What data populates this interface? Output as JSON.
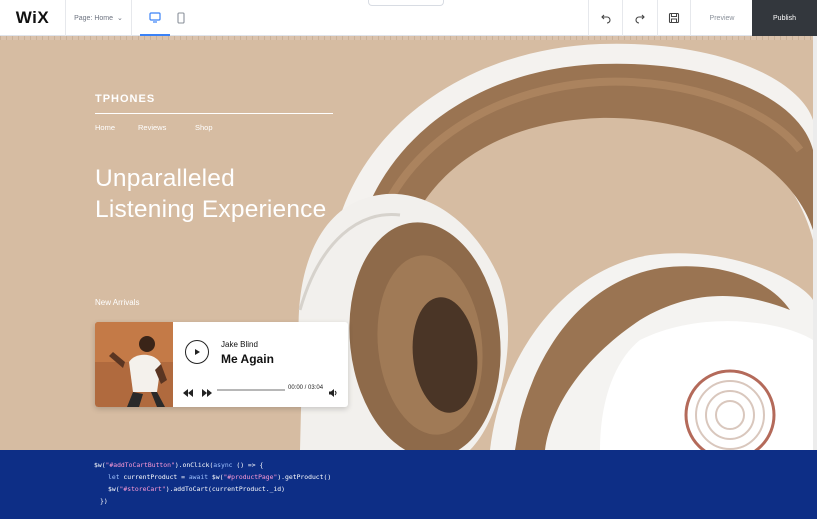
{
  "editor": {
    "logo": "WiX",
    "page_select_label": "Page: Home",
    "preview_label": "Preview",
    "publish_label": "Publish"
  },
  "site": {
    "brand": "TPHONES",
    "nav": [
      "Home",
      "Reviews",
      "Shop"
    ],
    "headline_line1": "Unparalleled",
    "headline_line2": "Listening Experience",
    "section_label": "New Arrivals"
  },
  "player": {
    "artist": "Jake Blind",
    "track": "Me Again",
    "time": "00:00 / 03:04",
    "progress_fraction": 0
  },
  "code": {
    "line1_a": "$w(",
    "line1_str": "\"#addToCartButton\"",
    "line1_b": ").onClick(",
    "line1_kw": "async",
    "line1_c": " () => {",
    "line2_kw1": "let",
    "line2_a": " currentProduct = ",
    "line2_kw2": "await",
    "line2_b": " $w(",
    "line2_str": "\"#productPage\"",
    "line2_c": ").getProduct()",
    "line3_a": "$w(",
    "line3_str": "\"#storeCart\"",
    "line3_b": ").addToCart(currentProduct._id)",
    "line4": "})"
  },
  "colors": {
    "canvas_bg": "#d6bca2",
    "code_bg": "#0d2e86",
    "publish_bg": "#33373d",
    "active_device": "#3b82f6"
  }
}
